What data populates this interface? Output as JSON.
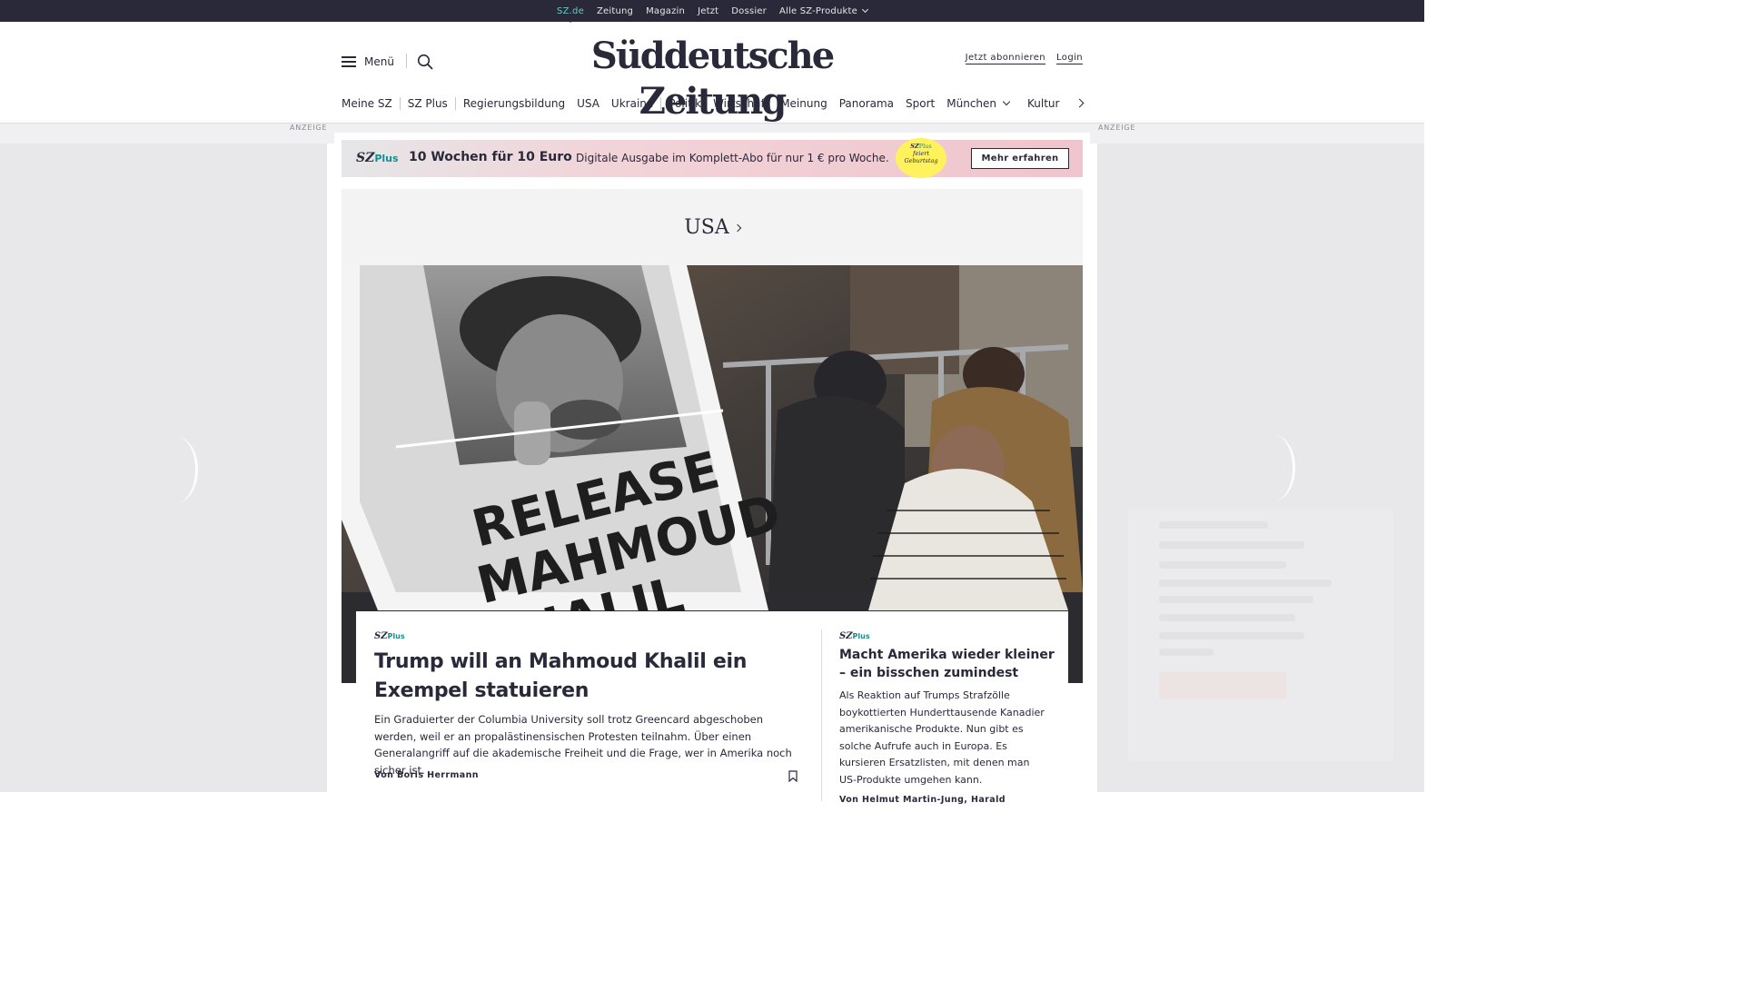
{
  "topbar": {
    "links": [
      "SZ.de",
      "Zeitung",
      "Magazin",
      "Jetzt",
      "Dossier",
      "Alle SZ-Produkte"
    ],
    "active": "SZ.de"
  },
  "header": {
    "menu_label": "Menü",
    "logo": "Süddeutsche Zeitung",
    "subscribe": "Jetzt abonnieren",
    "login": "Login"
  },
  "nav": {
    "items": [
      "Meine SZ",
      "SZ Plus",
      "Regierungsbildung",
      "USA",
      "Ukraine",
      "Politik",
      "Wirtschaft",
      "Meinung",
      "Panorama",
      "Sport",
      "München",
      "Kultur"
    ]
  },
  "ads": {
    "label_left": "ANZEIGE",
    "label_right": "ANZEIGE"
  },
  "promo": {
    "brand": "SZ",
    "brand_plus": "Plus",
    "headline": "10 Wochen für 10 Euro",
    "subline": "Digitale Ausgabe im Komplett-Abo für nur 1 € pro Woche.",
    "badge_brand": "SZ",
    "badge_plus": "Plus",
    "badge_line1": "feiert",
    "badge_line2": "Geburtstag",
    "cta": "Mehr erfahren"
  },
  "section": {
    "title": "USA"
  },
  "hero": {
    "sign_line1": "RELEASE",
    "sign_line2": "MAHMOUD",
    "sign_line3": "KHALIL"
  },
  "articles": [
    {
      "brand": "SZ",
      "plus": "Plus",
      "title": "Trump will an Mahmoud Khalil ein Exempel statuieren",
      "teaser": "Ein Graduierter der Columbia University soll trotz Greencard abgeschoben werden, weil er an propalästinensischen Protesten teilnahm. Über einen Generalangriff auf die akademische Freiheit und die Frage, wer in Amerika noch sicher ist.",
      "author": "Von Boris Herrmann"
    },
    {
      "brand": "SZ",
      "plus": "Plus",
      "title": "Macht Amerika wieder kleiner – ein bisschen zumindest",
      "teaser": "Als Reaktion auf Trumps Strafzölle boykottierten Hunderttausende Kanadier amerikanische Produkte.  Nun gibt es solche Aufrufe auch in Europa. Es kursieren Ersatzlisten, mit denen man US-Produkte umgehen kann.",
      "author": "Von Helmut Martin-Jung, Harald"
    }
  ],
  "colors": {
    "topbar": "#29293a",
    "accent_teal": "#0f8e91",
    "badge_yellow": "#fff25c",
    "promo_pink": "#f0c5cd"
  }
}
